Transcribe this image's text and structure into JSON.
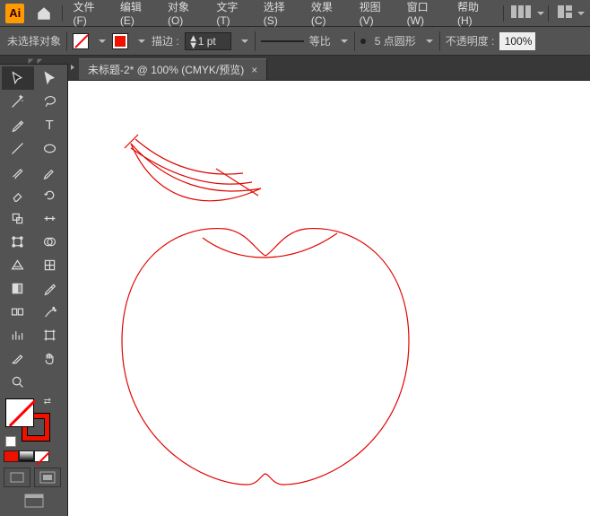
{
  "app": {
    "logo": "Ai"
  },
  "menu": {
    "file": "文件(F)",
    "edit": "编辑(E)",
    "object": "对象(O)",
    "text": "文字(T)",
    "select": "选择(S)",
    "effect": "效果(C)",
    "view": "视图(V)",
    "window": "窗口(W)",
    "help": "帮助(H)"
  },
  "control": {
    "selection_status": "未选择对象",
    "stroke_label": "描边 :",
    "stroke_value": "1 pt",
    "profile_label": "等比",
    "brush_label": "5 点圆形",
    "opacity_label": "不透明度 :",
    "opacity_value": "100%"
  },
  "document": {
    "tab_title": "未标题-2* @ 100% (CMYK/预览)"
  },
  "colors": {
    "accent_orange": "#ff9a00",
    "stroke_red": "#e10600",
    "panel": "#535353",
    "panel_dark": "#383838"
  },
  "tools": [
    "selection",
    "direct-selection",
    "magic-wand",
    "lasso",
    "pen",
    "type",
    "line",
    "ellipse",
    "paintbrush",
    "pencil",
    "eraser",
    "rotate",
    "scale",
    "width",
    "free-transform",
    "shape-builder",
    "perspective",
    "mesh",
    "gradient",
    "eyedropper",
    "blend",
    "symbol-sprayer",
    "column-graph",
    "artboard",
    "slice",
    "hand",
    "zoom",
    "spare"
  ]
}
